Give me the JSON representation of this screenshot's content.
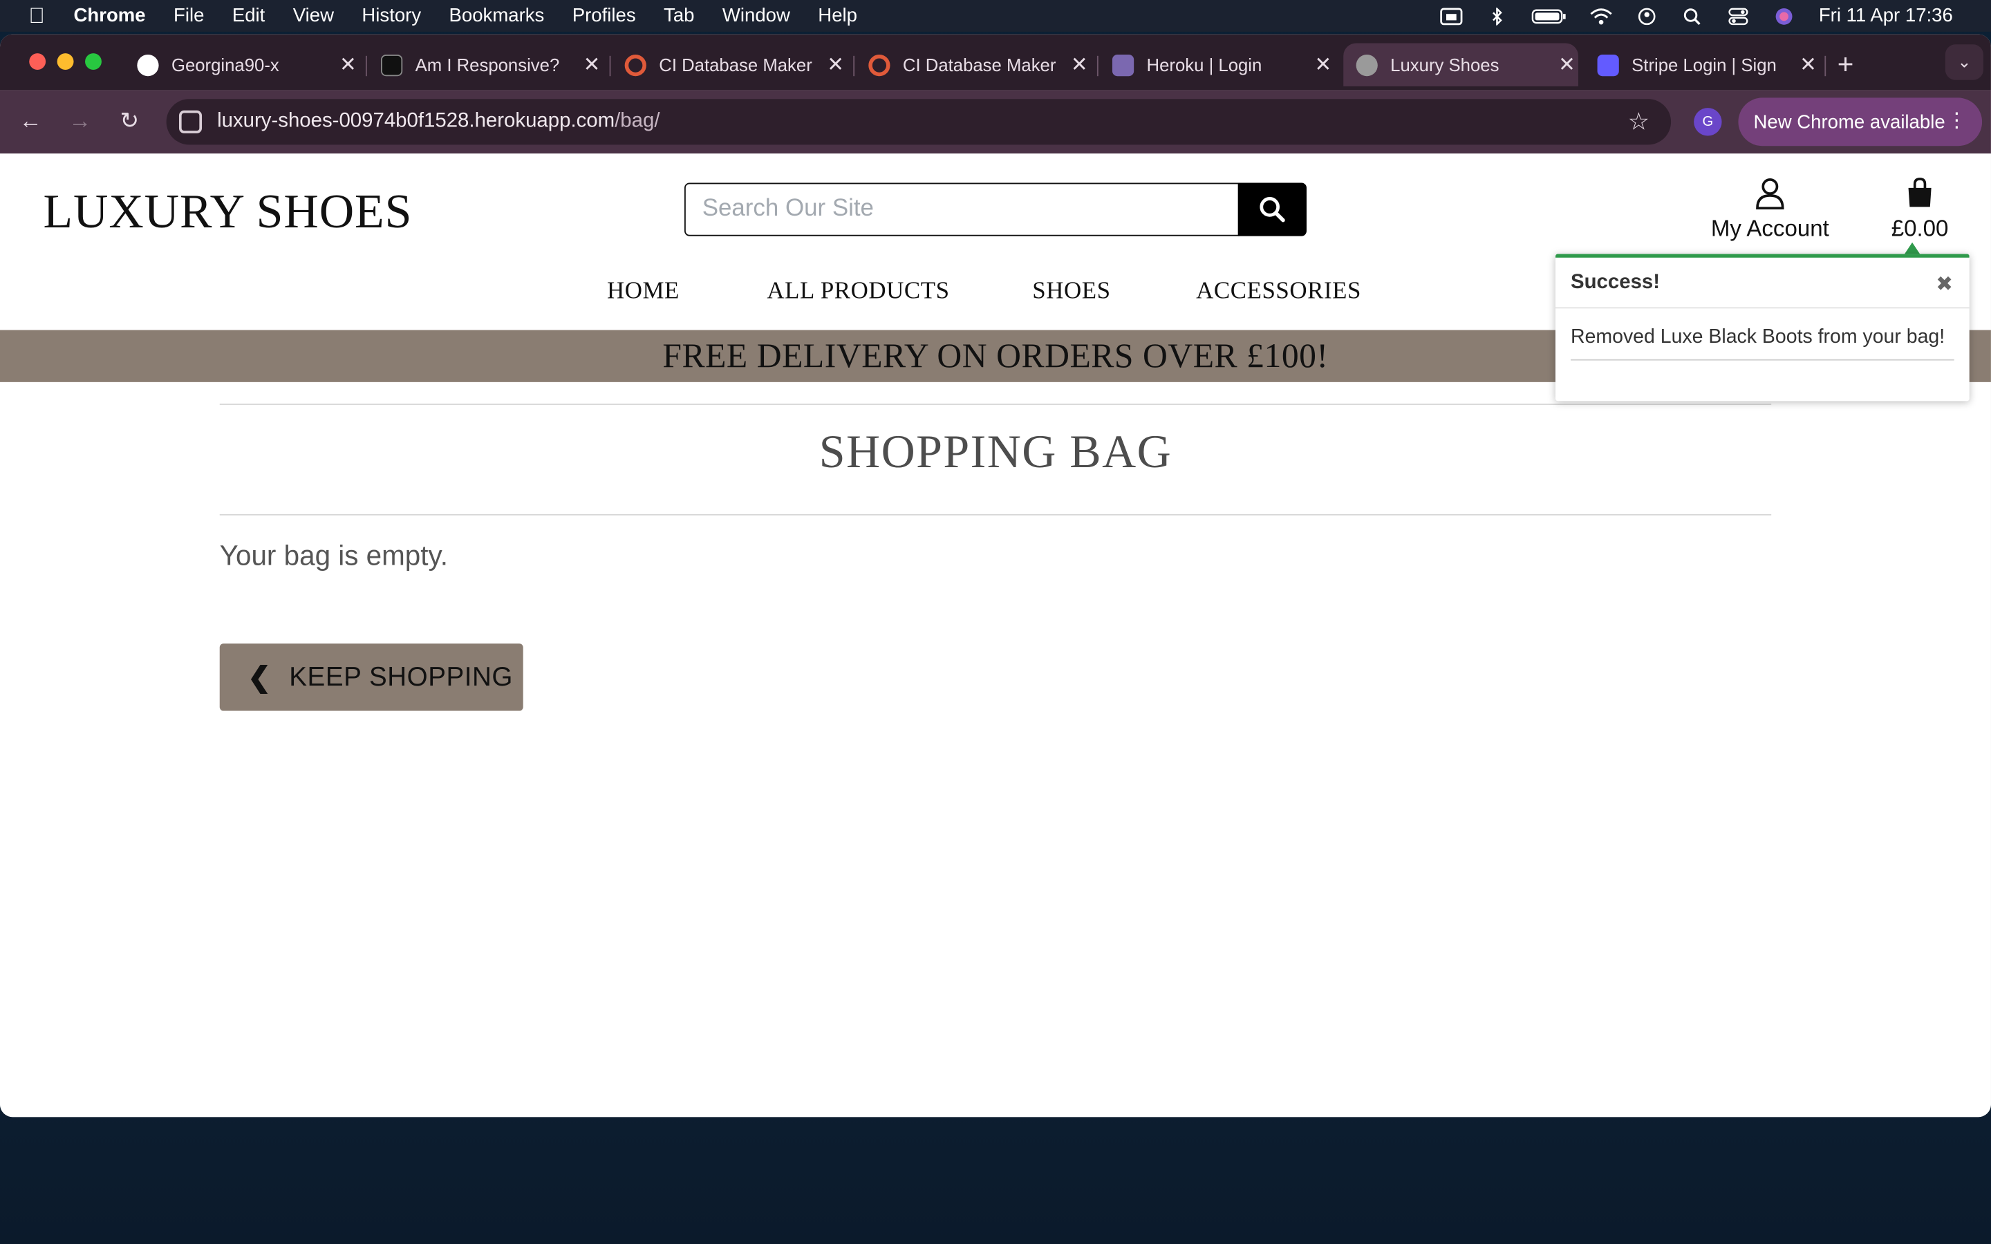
{
  "menubar": {
    "app": "Chrome",
    "items": [
      "File",
      "Edit",
      "View",
      "History",
      "Bookmarks",
      "Profiles",
      "Tab",
      "Window",
      "Help"
    ],
    "clock": "Fri 11 Apr  17:36"
  },
  "browser": {
    "tabs": [
      {
        "label": "Georgina90-x",
        "favicon_color": "#ffffff"
      },
      {
        "label": "Am I Responsive?",
        "favicon_color": "#111111"
      },
      {
        "label": "CI Database Maker",
        "favicon_color": "#e05a3a"
      },
      {
        "label": "CI Database Maker",
        "favicon_color": "#e05a3a"
      },
      {
        "label": "Heroku | Login",
        "favicon_color": "#7b68b0"
      },
      {
        "label": "Luxury Shoes",
        "favicon_color": "#9a9a9a"
      },
      {
        "label": "Stripe Login | Sign",
        "favicon_color": "#635bff"
      }
    ],
    "url_host": "luxury-shoes-00974b0f1528.herokuapp.com",
    "url_path": "/bag/",
    "profile_initial": "G",
    "update_label": "New Chrome available"
  },
  "site": {
    "logo": "LUXURY SHOES",
    "search_placeholder": "Search Our Site",
    "account_label": "My Account",
    "bag_total": "£0.00",
    "nav": [
      "HOME",
      "ALL PRODUCTS",
      "SHOES",
      "ACCESSORIES"
    ],
    "banner": "FREE DELIVERY ON ORDERS OVER £100!",
    "page_title": "SHOPPING BAG",
    "empty_message": "Your bag is empty.",
    "keep_shopping": "KEEP SHOPPING"
  },
  "toast": {
    "title": "Success!",
    "message": "Removed Luxe Black Boots from your bag!"
  },
  "colors": {
    "accent_brown": "#8a7d72",
    "success_green": "#2f9a4b",
    "tabstrip": "#2b1e2a"
  }
}
